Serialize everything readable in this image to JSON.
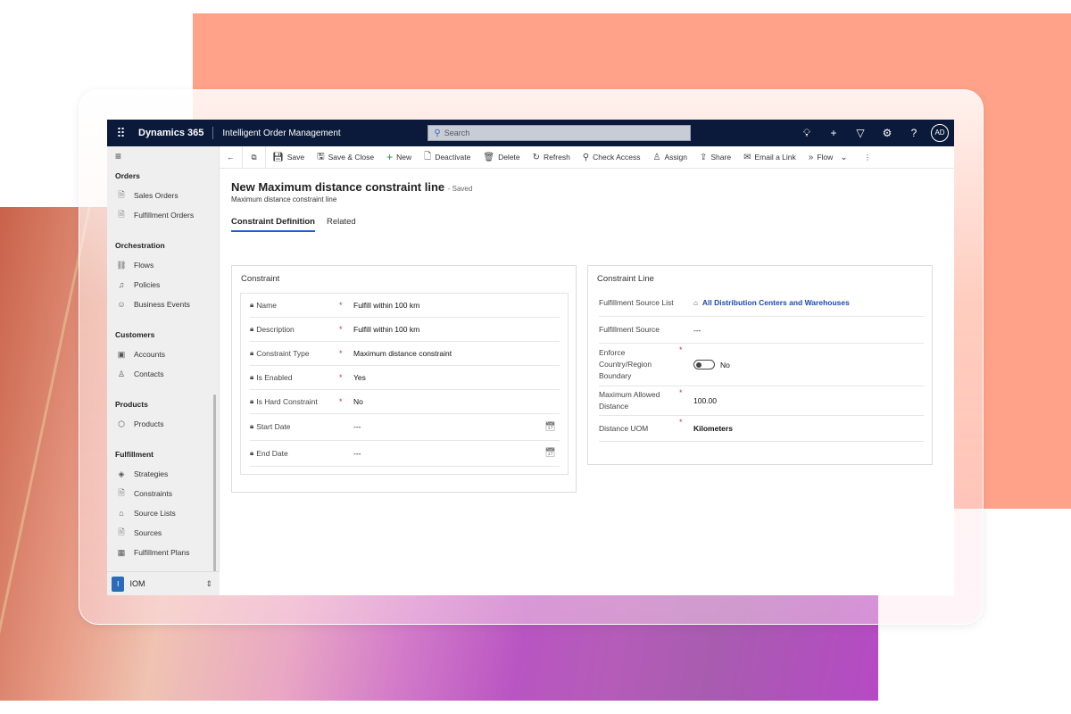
{
  "topbar": {
    "brand": "Dynamics 365",
    "app_name": "Intelligent Order Management",
    "search_placeholder": "Search",
    "user_initials": "AD"
  },
  "sidebar": {
    "groups": [
      {
        "label": "Orders",
        "items": [
          {
            "label": "Sales Orders",
            "icon": "document-icon"
          },
          {
            "label": "Fulfillment Orders",
            "icon": "document-gear-icon"
          }
        ]
      },
      {
        "label": "Orchestration",
        "items": [
          {
            "label": "Flows",
            "icon": "flow-icon"
          },
          {
            "label": "Policies",
            "icon": "policy-icon"
          },
          {
            "label": "Business Events",
            "icon": "event-icon"
          }
        ]
      },
      {
        "label": "Customers",
        "items": [
          {
            "label": "Accounts",
            "icon": "account-icon"
          },
          {
            "label": "Contacts",
            "icon": "person-icon"
          }
        ]
      },
      {
        "label": "Products",
        "items": [
          {
            "label": "Products",
            "icon": "box-icon"
          }
        ]
      },
      {
        "label": "Fulfillment",
        "items": [
          {
            "label": "Strategies",
            "icon": "strategy-icon"
          },
          {
            "label": "Constraints",
            "icon": "document-gear-icon"
          },
          {
            "label": "Source Lists",
            "icon": "list-icon"
          },
          {
            "label": "Sources",
            "icon": "source-icon"
          },
          {
            "label": "Fulfillment Plans",
            "icon": "plan-icon"
          }
        ]
      }
    ],
    "area": {
      "badge": "I",
      "label": "IOM"
    }
  },
  "commands": {
    "save": "Save",
    "save_close": "Save & Close",
    "new": "New",
    "deactivate": "Deactivate",
    "delete": "Delete",
    "refresh": "Refresh",
    "check_access": "Check Access",
    "assign": "Assign",
    "share": "Share",
    "email_link": "Email a Link",
    "flow": "Flow"
  },
  "record": {
    "title": "New Maximum distance constraint line",
    "status": "- Saved",
    "entity": "Maximum distance constraint line"
  },
  "tabs": [
    {
      "label": "Constraint Definition",
      "active": true
    },
    {
      "label": "Related",
      "active": false
    }
  ],
  "constraint": {
    "title": "Constraint",
    "fields": [
      {
        "label": "Name",
        "required": true,
        "value": "Fulfill within 100 km"
      },
      {
        "label": "Description",
        "required": true,
        "value": "Fulfill within 100 km"
      },
      {
        "label": "Constraint Type",
        "required": true,
        "value": "Maximum distance constraint"
      },
      {
        "label": "Is Enabled",
        "required": true,
        "value": "Yes"
      },
      {
        "label": "Is Hard Constraint",
        "required": true,
        "value": "No"
      },
      {
        "label": "Start Date",
        "required": false,
        "value": "---"
      },
      {
        "label": "End Date",
        "required": false,
        "value": "---"
      }
    ]
  },
  "constraint_line": {
    "title": "Constraint Line",
    "source_list_label": "Fulfillment Source List",
    "source_list_value": "All Distribution Centers and Warehouses",
    "source_label": "Fulfillment Source",
    "source_value": "---",
    "enforce_label": "Enforce Country/Region Boundary",
    "enforce_value": "No",
    "max_distance_label": "Maximum Allowed Distance",
    "max_distance_value": "100.00",
    "uom_label": "Distance UOM",
    "uom_value": "Kilometers"
  }
}
